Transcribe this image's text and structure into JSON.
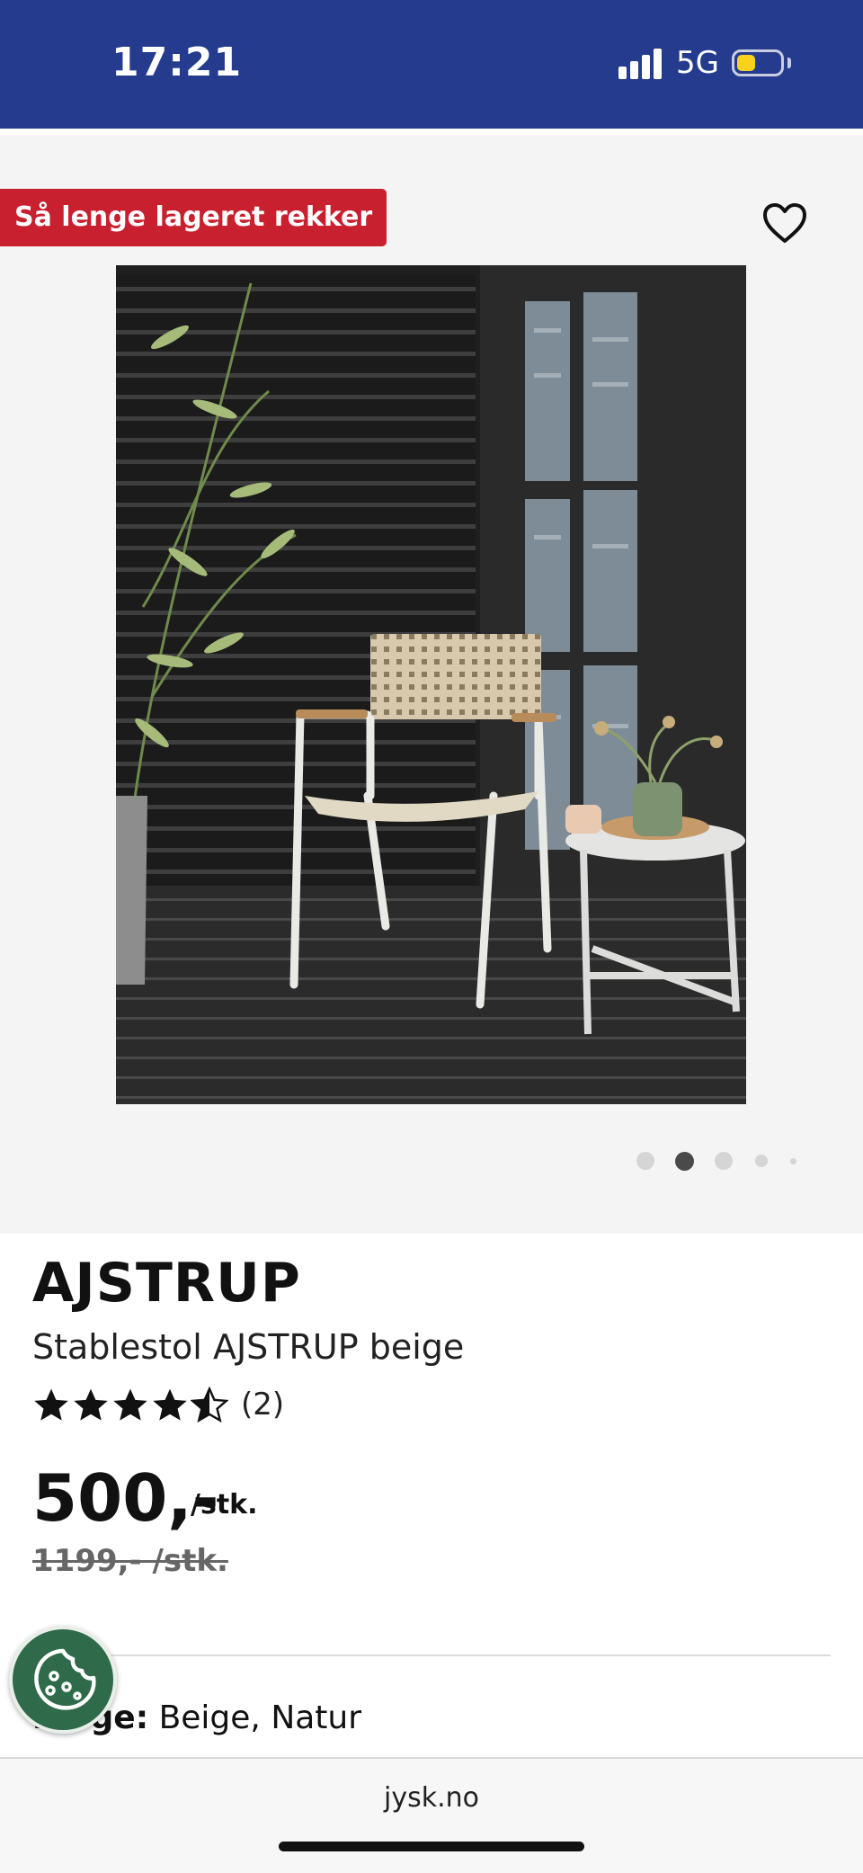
{
  "status_bar": {
    "time": "17:21",
    "network": "5G",
    "battery_color": "#f8d21c",
    "background": "#243b8e"
  },
  "product": {
    "promo_badge": "Så lenge lageret rekker",
    "brand": "AJSTRUP",
    "name": "Stablestol AJSTRUP beige",
    "rating": 4.5,
    "review_count": "(2)",
    "price": "500,-",
    "unit": "/stk.",
    "old_price": "1199,- /stk.",
    "color_label": "Farge:",
    "color_value": "Beige, Natur"
  },
  "gallery": {
    "image_count": 5,
    "active_index": 1
  },
  "browser": {
    "url": "jysk.no"
  },
  "colors": {
    "promo": "#c8202f",
    "cookie": "#2f6a4a"
  }
}
